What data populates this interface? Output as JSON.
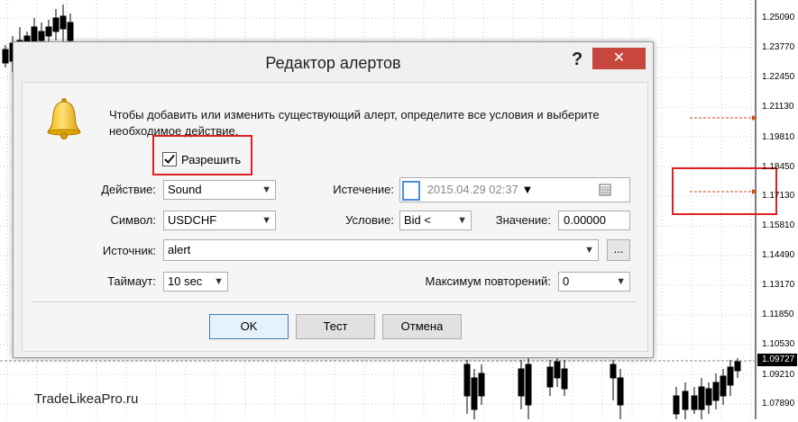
{
  "chart": {
    "price_labels": [
      "1.25090",
      "1.23770",
      "1.22450",
      "1.21130",
      "1.19810",
      "1.18450",
      "1.17130",
      "1.15810",
      "1.14490",
      "1.13170",
      "1.11850",
      "1.10530",
      "1.09727",
      "1.09210",
      "1.07890"
    ],
    "current_price": "1.09727",
    "watermark": "TradeLikeaPro.ru",
    "colors": {
      "alert_line": "#d04a1a",
      "highlight": "#e02020",
      "candle": "#000000"
    }
  },
  "dialog": {
    "title": "Редактор алертов",
    "help_label": "?",
    "close_label": "✕",
    "info_text": "Чтобы добавить или изменить существующий алерт, определите все условия и выберите необходимое действие.",
    "enable_label": "Разрешить",
    "enable_checked": true,
    "action_label": "Действие:",
    "action_value": "Sound",
    "expiry_label": "Истечение:",
    "expiry_value": "2015.04.29 02:37",
    "symbol_label": "Символ:",
    "symbol_value": "USDCHF",
    "condition_label": "Условие:",
    "condition_value": "Bid <",
    "value_label": "Значение:",
    "value_value": "0.00000",
    "source_label": "Источник:",
    "source_value": "alert",
    "browse_label": "...",
    "timeout_label": "Таймаут:",
    "timeout_value": "10 sec",
    "max_repeats_label": "Максимум повторений:",
    "max_repeats_value": "0",
    "ok_label": "OK",
    "test_label": "Тест",
    "cancel_label": "Отмена"
  },
  "icons": [
    "bell-icon",
    "calendar-icon",
    "chevron-down-icon",
    "checkmark-icon",
    "close-icon",
    "help-icon"
  ]
}
